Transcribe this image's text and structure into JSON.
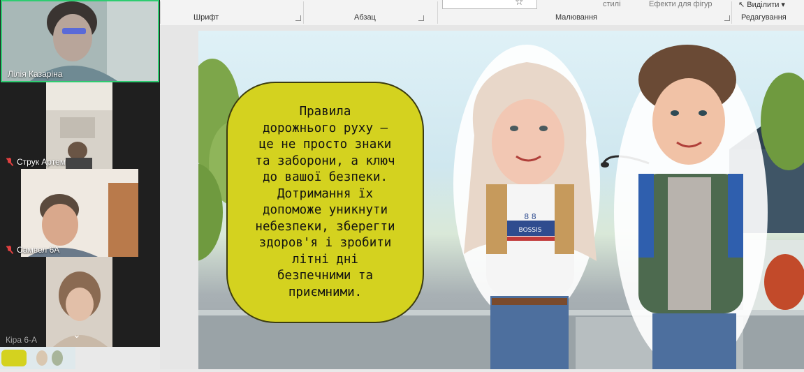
{
  "participants": [
    {
      "name": "Лілія Казаріна",
      "muted": false,
      "active": true
    },
    {
      "name": "Струк Артем",
      "muted": true
    },
    {
      "name": "Самвел 6А",
      "muted": true
    },
    {
      "name": "Кіра 6-А",
      "muted": false
    }
  ],
  "ribbon": {
    "groups": {
      "font": "Шрифт",
      "paragraph": "Абзац",
      "drawing": "Малювання",
      "editing": "Редагування"
    },
    "faint_items": {
      "styles": "стилі",
      "shape_effects": "Ефекти для фігур",
      "select": "Виділити"
    }
  },
  "slide": {
    "text": "Правила дорожнього руху — це не просто знаки та заборони, а ключ до вашої безпеки. Дотримання їх допоможе уникнути небезпеки, зберегти здоров'я і зробити літні дні безпечними та приємними.",
    "shirt_text": "BOSSIS 88",
    "text_lines": [
      "Правила",
      "дорожнього руху —",
      "це не просто знаки",
      "та заборони, а ключ",
      "до вашої безпеки.",
      "Дотримання їх",
      "допоможе уникнути",
      "небезпеки, зберегти",
      "здоров'я і зробити",
      "літні дні",
      "безпечними та",
      "приємними."
    ]
  },
  "colors": {
    "textbox_fill": "#d4d21f",
    "active_speaker_border": "#2ecc71",
    "muted_mic": "#e04040"
  }
}
